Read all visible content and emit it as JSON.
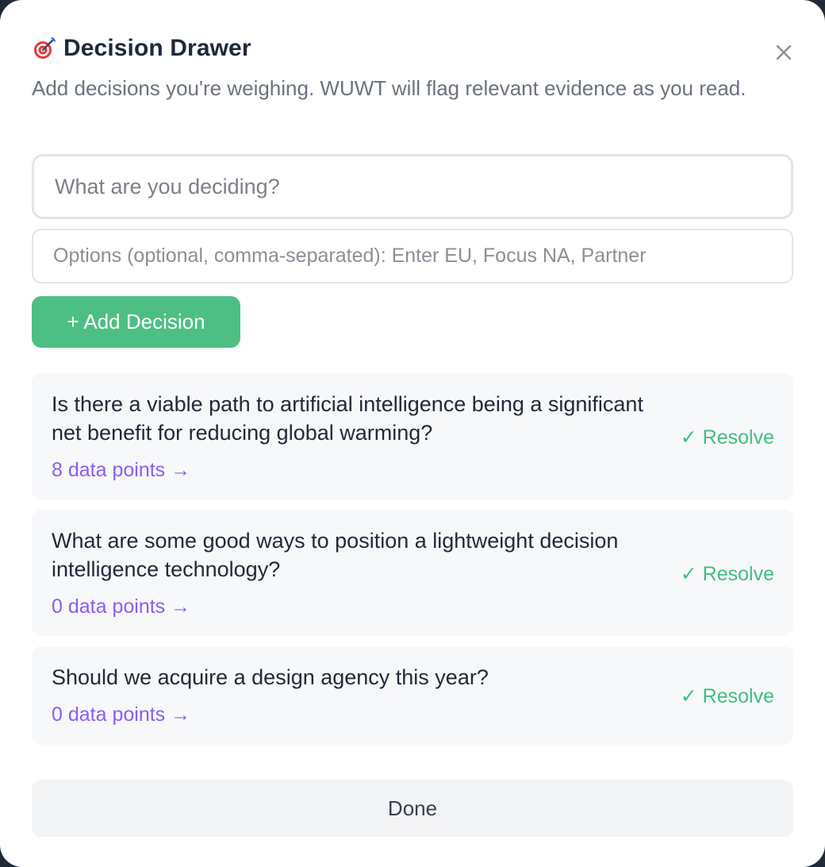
{
  "header": {
    "title": "Decision Drawer",
    "icon": "target-dart-icon",
    "close_icon": "close-icon"
  },
  "subtitle": "Add decisions you're weighing. WUWT will flag relevant evidence as you read.",
  "form": {
    "decision_placeholder": "What are you deciding?",
    "decision_value": "",
    "options_placeholder": "Options (optional, comma-separated): Enter EU, Focus NA, Partner",
    "options_value": "",
    "add_button_label": "+ Add Decision"
  },
  "decisions": [
    {
      "question": "Is there a viable path to artificial intelligence being a significant net benefit for reducing global warming?",
      "data_points_label": "8 data points →",
      "resolve_label": "✓ Resolve"
    },
    {
      "question": "What are some good ways to position a lightweight decision intelligence technology?",
      "data_points_label": "0 data points →",
      "resolve_label": "✓ Resolve"
    },
    {
      "question": "Should we acquire a design agency this year?",
      "data_points_label": "0 data points →",
      "resolve_label": "✓ Resolve"
    }
  ],
  "footer": {
    "done_label": "Done"
  },
  "colors": {
    "accent_green": "#4ebf84",
    "link_purple": "#8b5cf6",
    "resolve_green": "#3fbf7f"
  }
}
